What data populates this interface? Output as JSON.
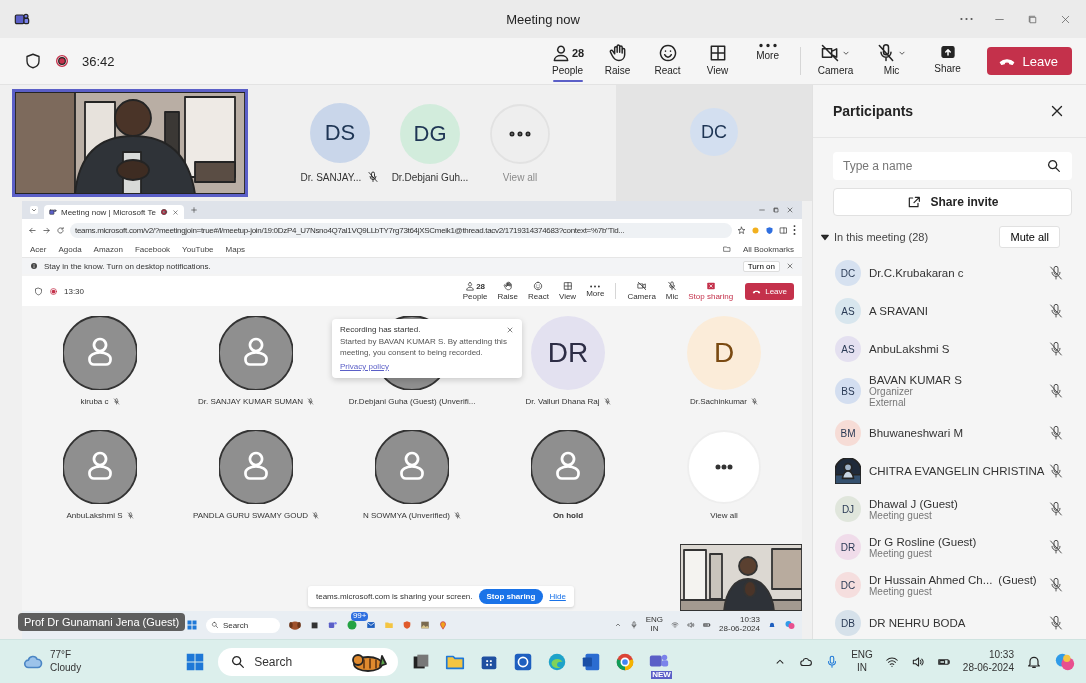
{
  "window": {
    "title": "Meeting now"
  },
  "toolbar": {
    "recording": true,
    "timer": "36:42",
    "buttons": [
      {
        "kind": "people",
        "label": "People",
        "count": "28",
        "selected": true
      },
      {
        "kind": "raise",
        "label": "Raise",
        "selected": false
      },
      {
        "kind": "react",
        "label": "React",
        "selected": false
      },
      {
        "kind": "view",
        "label": "View",
        "selected": false
      },
      {
        "kind": "more",
        "label": "More",
        "selected": false
      }
    ],
    "devices": [
      {
        "kind": "camera",
        "label": "Camera"
      },
      {
        "kind": "mic",
        "label": "Mic"
      },
      {
        "kind": "share",
        "label": "Share"
      }
    ],
    "leave": "Leave"
  },
  "stage": {
    "tiles": [
      {
        "kind": "video"
      },
      {
        "kind": "avatar",
        "initials": "DS",
        "color": "#c9d6ea",
        "name": "Dr. SANJAY...",
        "muted": true
      },
      {
        "kind": "avatar",
        "initials": "DG",
        "color": "#d2ecdc",
        "name": "Dr.Debjani Guh..."
      },
      {
        "kind": "more",
        "name": "View all"
      }
    ],
    "spotlight": {
      "initials": "DC",
      "color": "#d3dff0"
    },
    "caption": "Prof Dr Gunamani Jena (Guest)"
  },
  "shared_screen": {
    "browser": {
      "tab": "Meeting now | Microsoft Te",
      "url": "teams.microsoft.com/v2/?meetingjoin=true#/l/meetup-join/19:0DzP4_U7Nsno4Q7al1VQ9LLbTY7rg73t64jXSCmeik1@thread.tacv2/1719314374683?context=%7b\"Tid...",
      "bookmarks": [
        "Acer",
        "Agoda",
        "Amazon",
        "Facebook",
        "YouTube",
        "Maps"
      ],
      "all_bookmarks": "All Bookmarks",
      "notice": "Stay in the know. Turn on desktop notifications.",
      "notice_button": "Turn on"
    },
    "meeting": {
      "recording": true,
      "timer": "13:30",
      "people_count": "28",
      "buttons": [
        {
          "kind": "people",
          "label": "People"
        },
        {
          "kind": "raise",
          "label": "Raise"
        },
        {
          "kind": "react",
          "label": "React"
        },
        {
          "kind": "view",
          "label": "View"
        },
        {
          "kind": "more",
          "label": "More"
        },
        {
          "kind": "camera",
          "label": "Camera"
        },
        {
          "kind": "mic",
          "label": "Mic"
        },
        {
          "kind": "stop",
          "label": "Stop sharing"
        }
      ],
      "leave": "Leave"
    },
    "tiles": [
      {
        "kind": "person",
        "name": "kiruba c",
        "muted": true
      },
      {
        "kind": "person",
        "name": "Dr. SANJAY KUMAR SUMAN",
        "muted": true
      },
      {
        "kind": "person",
        "name": "Dr.Debjani Guha (Guest) (Unverifi..."
      },
      {
        "kind": "avatar",
        "initials": "DR",
        "color": "#e3e1f0",
        "name": "Dr. Valluri Dhana Raj",
        "muted": true
      },
      {
        "kind": "avatar",
        "initials": "D",
        "color": "#fbecd9",
        "name": "Dr.Sachinkumar",
        "muted": true
      },
      {
        "kind": "person",
        "name": "AnbuLakshmi S",
        "muted": true
      },
      {
        "kind": "person",
        "name": "PANDLA GURU SWAMY GOUD",
        "muted": true
      },
      {
        "kind": "person",
        "name": "N SOWMYA (Unverified)",
        "muted": true
      },
      {
        "kind": "hold",
        "name": "On hold"
      },
      {
        "kind": "more",
        "name": "View all"
      }
    ],
    "popup": {
      "title": "Recording has started.",
      "text": "Started by BAVAN KUMAR S. By attending this meeting, you consent to being recorded.",
      "link": "Privacy policy"
    },
    "share_bar": {
      "text": "teams.microsoft.com is sharing your screen.",
      "stop": "Stop sharing",
      "hide": "Hide"
    },
    "taskbar": {
      "search": "Search",
      "badge": "99+",
      "language": "ENG",
      "region": "IN",
      "time": "10:33",
      "date": "28-06-2024"
    }
  },
  "participants": {
    "title": "Participants",
    "search_placeholder": "Type a name",
    "share_invite": "Share invite",
    "section": {
      "label": "In this meeting (28)",
      "expanded": true,
      "mute_all": "Mute all"
    },
    "items": [
      {
        "kind": "initials",
        "initials": "DC",
        "color": "#d6e1f0",
        "name": "Dr.C.Krubakaran c",
        "muted": true
      },
      {
        "kind": "initials",
        "initials": "AS",
        "color": "#d8e6ee",
        "name": "A SRAVANI",
        "muted": true
      },
      {
        "kind": "initials",
        "initials": "AS",
        "color": "#e4e0f0",
        "name": "AnbuLakshmi S",
        "muted": true
      },
      {
        "kind": "initials",
        "initials": "BS",
        "color": "#d3def0",
        "name": "BAVAN KUMAR S",
        "details": [
          "Organizer",
          "External"
        ],
        "muted": true
      },
      {
        "kind": "initials",
        "initials": "BM",
        "color": "#f6dcd6",
        "name": "Bhuwaneshwari M",
        "muted": true
      },
      {
        "name": "CHITRA EVANGELIN CHRISTINA",
        "muted": true
      },
      {
        "kind": "initials",
        "initials": "DJ",
        "color": "#e0e6dc",
        "name": "Dhawal J (Guest)",
        "details": [
          "Meeting guest"
        ],
        "muted": true
      },
      {
        "kind": "initials",
        "initials": "DR",
        "color": "#f0dcea",
        "name": "Dr G Rosline (Guest)",
        "details": [
          "Meeting guest"
        ],
        "muted": true
      },
      {
        "kind": "initials",
        "initials": "DC",
        "color": "#f5dede",
        "name": "Dr Hussain Ahmed Ch...",
        "tag": "(Guest)",
        "details": [
          "Meeting guest"
        ],
        "muted": true
      },
      {
        "kind": "initials",
        "initials": "DB",
        "color": "#d6e1ea",
        "name": "DR NEHRU BODA",
        "muted": true
      }
    ]
  },
  "taskbar": {
    "temperature": "77°F",
    "weather": "Cloudy",
    "search": "Search",
    "teams_badge": "NEW",
    "language": "ENG",
    "region": "IN",
    "time": "10:33",
    "date": "28-06-2024"
  }
}
